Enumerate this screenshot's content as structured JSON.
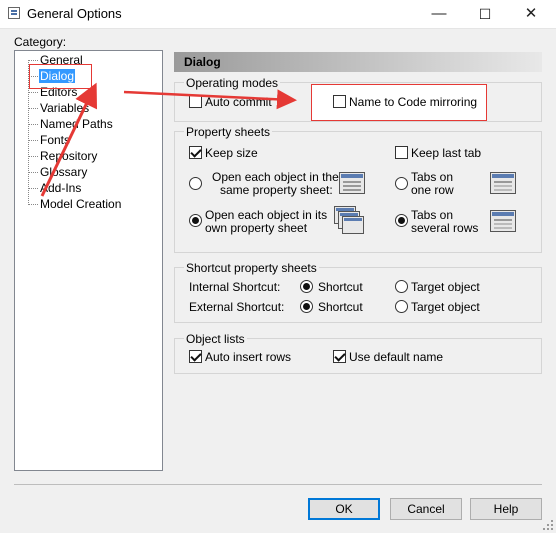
{
  "window": {
    "title": "General Options",
    "minimize": "—",
    "maximize": "☐",
    "close": "✕"
  },
  "category": {
    "label": "Category:",
    "items": [
      {
        "label": "General"
      },
      {
        "label": "Dialog"
      },
      {
        "label": "Editors"
      },
      {
        "label": "Variables"
      },
      {
        "label": "Named Paths"
      },
      {
        "label": "Fonts"
      },
      {
        "label": "Repository"
      },
      {
        "label": "Glossary"
      },
      {
        "label": "Add-Ins"
      },
      {
        "label": "Model Creation"
      }
    ],
    "selected": "Dialog"
  },
  "section_title": "Dialog",
  "operating_modes": {
    "title": "Operating modes",
    "auto_commit": {
      "label": "Auto commit",
      "checked": false
    },
    "name_to_code": {
      "label": "Name to Code mirroring",
      "checked": false
    }
  },
  "property_sheets": {
    "title": "Property sheets",
    "keep_size": {
      "label": "Keep size",
      "checked": true
    },
    "keep_last_tab": {
      "label": "Keep last tab",
      "checked": false
    },
    "open_same": {
      "line1": "Open each object in the",
      "line2": "same property sheet:",
      "selected": false
    },
    "open_own": {
      "line1": "Open each object in its",
      "line2": "own property sheet",
      "selected": true
    },
    "tabs_one_row": {
      "line1": "Tabs on",
      "line2": "one row",
      "selected": false
    },
    "tabs_several_rows": {
      "line1": "Tabs on",
      "line2": "several rows",
      "selected": true
    }
  },
  "shortcut_sheets": {
    "title": "Shortcut property sheets",
    "internal": {
      "label": "Internal Shortcut:",
      "option_shortcut": "Shortcut",
      "option_target": "Target object",
      "value": "Shortcut"
    },
    "external": {
      "label": "External Shortcut:",
      "option_shortcut": "Shortcut",
      "option_target": "Target object",
      "value": "Shortcut"
    }
  },
  "object_lists": {
    "title": "Object lists",
    "auto_insert_rows": {
      "label": "Auto insert rows",
      "checked": true
    },
    "use_default_name": {
      "label": "Use default name",
      "checked": true
    }
  },
  "buttons": {
    "ok": "OK",
    "cancel": "Cancel",
    "help": "Help"
  },
  "annotation_color": "#e53935",
  "selection_color": "#3399ff"
}
